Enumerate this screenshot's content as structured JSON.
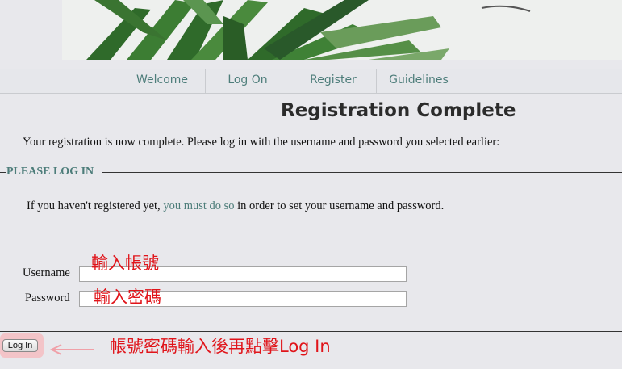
{
  "banner": {
    "image": "plant-leaves-banner"
  },
  "nav": {
    "items": [
      {
        "label": "Welcome"
      },
      {
        "label": "Log On"
      },
      {
        "label": "Register"
      },
      {
        "label": "Guidelines"
      }
    ]
  },
  "main": {
    "title": "Registration Complete",
    "intro": "Your registration is now complete. Please log in with the username and password you selected earlier:",
    "fieldset_legend": "PLEASE LOG IN",
    "note_before": "If you haven't registered yet,",
    "note_link": "you must do so",
    "note_after": "in order to set your username and password.",
    "username_label": "Username",
    "username_value": "",
    "password_label": "Password",
    "password_value": "",
    "login_button": "Log In"
  },
  "annotations": {
    "username_hint": "輸入帳號",
    "password_hint": "輸入密碼",
    "button_hint": "帳號密碼輸入後再點擊Log In",
    "color": "#e0141a"
  },
  "colors": {
    "link": "#4d7d7a",
    "background": "#e8e8ec",
    "highlight": "#f3c4c8"
  }
}
